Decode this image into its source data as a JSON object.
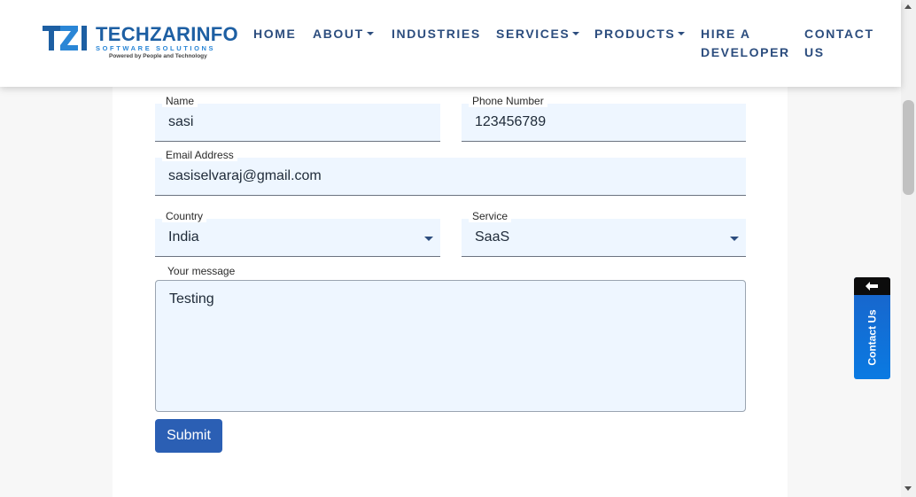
{
  "brand": {
    "name": "TECHZARINFO",
    "subtitle": "SOFTWARE SOLUTIONS",
    "tagline": "Powered by People and Technology",
    "colors": {
      "primary": "#1d5fa3",
      "accent": "#2a86d6",
      "button": "#2b5fb4"
    }
  },
  "nav": {
    "home": "HOME",
    "about": "ABOUT",
    "industries": "INDUSTRIES",
    "services": "SERVICES",
    "products": "PRODUCTS",
    "hire_line1": "HIRE A",
    "hire_line2": "DEVELOPER",
    "contact_line1": "CONTACT",
    "contact_line2": "US"
  },
  "form": {
    "name": {
      "label": "Name",
      "value": "sasi"
    },
    "phone": {
      "label": "Phone Number",
      "value": "123456789"
    },
    "email": {
      "label": "Email Address",
      "value": "sasiselvaraj@gmail.com"
    },
    "country": {
      "label": "Country",
      "value": "India"
    },
    "service": {
      "label": "Service",
      "value": "SaaS"
    },
    "message": {
      "label": "Your message",
      "value": "Testing"
    },
    "submit_label": "Submit"
  },
  "side_tab": {
    "label": "Contact Us",
    "icon": "arrow-left-icon"
  }
}
